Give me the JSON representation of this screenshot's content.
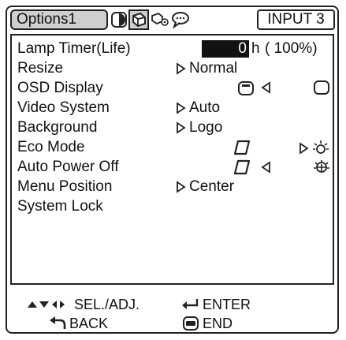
{
  "header": {
    "active_tab": "Options1",
    "input_label": "INPUT 3"
  },
  "menu": {
    "items": [
      {
        "label": "Lamp Timer(Life)"
      },
      {
        "label": "Resize"
      },
      {
        "label": "OSD Display"
      },
      {
        "label": "Video System"
      },
      {
        "label": "Background"
      },
      {
        "label": "Eco Mode"
      },
      {
        "label": "Auto Power Off"
      },
      {
        "label": "Menu Position"
      },
      {
        "label": "System Lock"
      }
    ],
    "lamp_timer_value": "0",
    "lamp_timer_unit": "h",
    "lamp_timer_life": "( 100%)",
    "resize_value": "Normal",
    "video_system_value": "Auto",
    "background_value": "Logo",
    "menu_position_value": "Center"
  },
  "footer": {
    "sel_adj": "SEL./ADJ.",
    "enter": "ENTER",
    "back": "BACK",
    "end": "END"
  }
}
